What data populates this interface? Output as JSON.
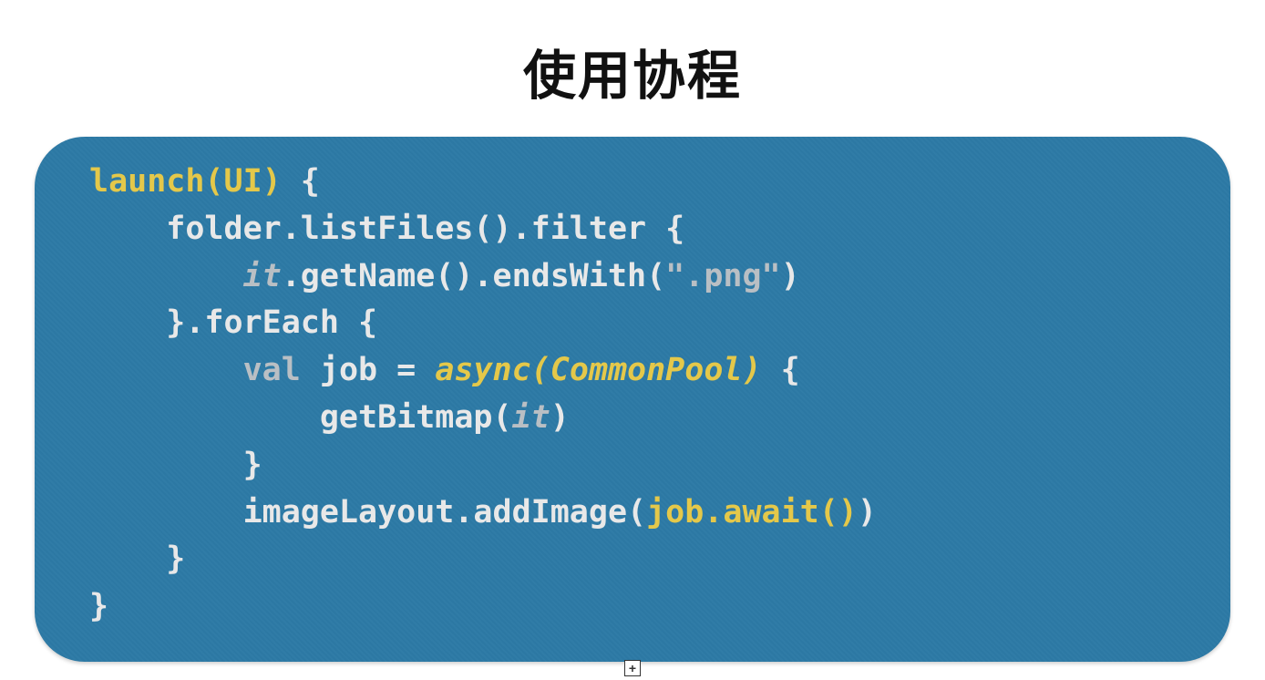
{
  "title": "使用协程",
  "code": {
    "line1": {
      "a": "launch(UI)",
      "b": " {"
    },
    "line2": {
      "a": "    folder.listFiles().filter {"
    },
    "line3": {
      "a": "        ",
      "b": "it",
      "c": ".getName().endsWith(",
      "d": "\".png\"",
      "e": ")"
    },
    "line4": {
      "a": "    }.forEach {"
    },
    "line5": {
      "a": "        ",
      "b": "val",
      "c": " job = ",
      "d": "async(CommonPool)",
      "e": " {"
    },
    "line6": {
      "a": "            getBitmap(",
      "b": "it",
      "c": ")"
    },
    "line7": {
      "a": "        }"
    },
    "line8": {
      "a": "        imageLayout.addImage(",
      "b": "job.await()",
      "c": ")"
    },
    "line9": {
      "a": "    }"
    },
    "line10": {
      "a": "}"
    }
  },
  "expand_icon": "expand"
}
